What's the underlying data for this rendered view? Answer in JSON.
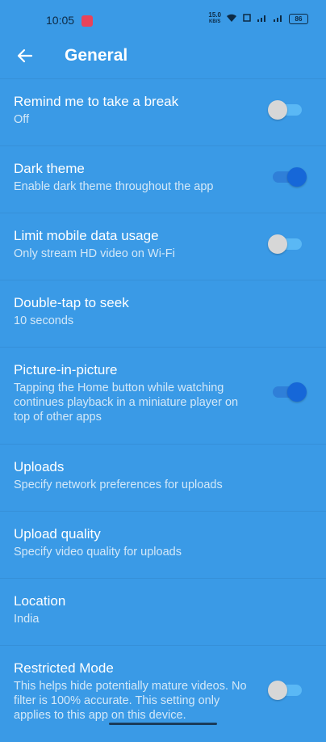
{
  "status_bar": {
    "time": "10:05",
    "speed_value": "15.0",
    "speed_unit": "KB/S",
    "battery": "86",
    "app_icon_color": "#e8435a"
  },
  "app_bar": {
    "title": "General",
    "back_icon": "arrow-left-icon"
  },
  "settings": {
    "items": [
      {
        "title": "Remind me to take a break",
        "subtitle": "Off",
        "toggle": "off"
      },
      {
        "title": "Dark theme",
        "subtitle": "Enable dark theme throughout the app",
        "toggle": "on"
      },
      {
        "title": "Limit mobile data usage",
        "subtitle": "Only stream HD video on Wi-Fi",
        "toggle": "off"
      },
      {
        "title": "Double-tap to seek",
        "subtitle": "10 seconds"
      },
      {
        "title": "Picture-in-picture",
        "subtitle": "Tapping the Home button while watching continues playback in a miniature player on top of other apps",
        "toggle": "on"
      },
      {
        "title": "Uploads",
        "subtitle": "Specify network preferences for uploads"
      },
      {
        "title": "Upload quality",
        "subtitle": "Specify video quality for uploads"
      },
      {
        "title": "Location",
        "subtitle": "India"
      },
      {
        "title": "Restricted Mode",
        "subtitle": "This helps hide potentially mature videos. No filter is 100% accurate. This setting only applies to this app on this device.",
        "toggle": "off"
      }
    ]
  },
  "colors": {
    "background": "#3a9ae6",
    "toggle_on": "#1667d8",
    "toggle_off_thumb": "#d7d7d7"
  }
}
